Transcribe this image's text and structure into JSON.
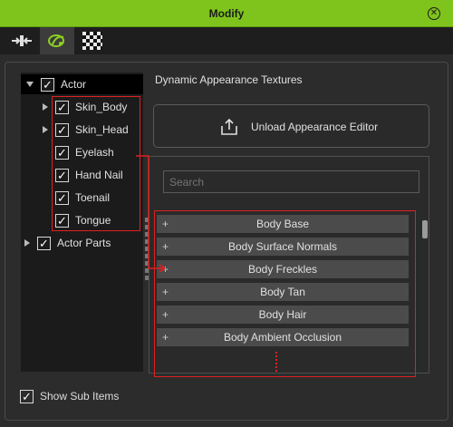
{
  "window": {
    "title": "Modify",
    "close_icon": "close-circle-icon"
  },
  "tabs": [
    {
      "icon": "attach-icon",
      "active": false
    },
    {
      "icon": "appearance-icon",
      "active": true
    },
    {
      "icon": "checker-texture-icon",
      "active": false
    }
  ],
  "tree": {
    "items": [
      {
        "label": "Actor",
        "checked": true,
        "expanded": true,
        "selected": true
      },
      {
        "label": "Skin_Body",
        "checked": true,
        "has_children": true
      },
      {
        "label": "Skin_Head",
        "checked": true,
        "has_children": true
      },
      {
        "label": "Eyelash",
        "checked": true
      },
      {
        "label": "Hand Nail",
        "checked": true
      },
      {
        "label": "Toenail",
        "checked": true
      },
      {
        "label": "Tongue",
        "checked": true
      },
      {
        "label": "Actor Parts",
        "checked": true,
        "has_children": true
      }
    ]
  },
  "section_heading": "Dynamic Appearance Textures",
  "unload_button": {
    "label": "Unload Appearance Editor",
    "icon": "upload-icon"
  },
  "search": {
    "placeholder": "Search",
    "value": ""
  },
  "texture_list": {
    "items": [
      "Body Base",
      "Body Surface Normals",
      "Body Freckles",
      "Body Tan",
      "Body Hair",
      "Body Ambient Occlusion"
    ]
  },
  "show_sub_items": {
    "label": "Show Sub Items",
    "checked": true
  },
  "colors": {
    "title_bar": "#7fc41c",
    "highlight": "#e02020"
  }
}
